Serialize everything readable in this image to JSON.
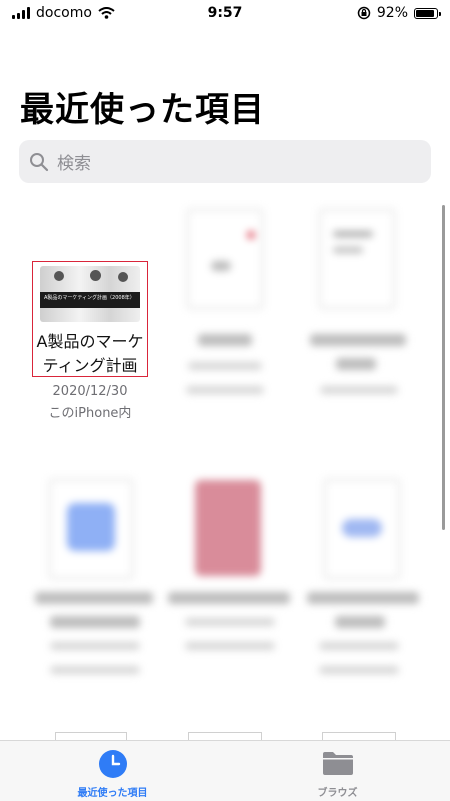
{
  "status": {
    "carrier": "docomo",
    "time": "9:57",
    "battery": "92%"
  },
  "page_title": "最近使った項目",
  "search": {
    "placeholder": "検索"
  },
  "files": [
    {
      "name_line1": "A製品のマーケ",
      "name_line2": "ティング計画",
      "date": "2020/12/30",
      "location": "このiPhone内",
      "thumb_caption": "A製品のマーケティング計画（2008年）"
    }
  ],
  "tabbar": {
    "recent_label": "最近使った項目",
    "browse_label": "ブラウズ"
  },
  "colors": {
    "accent": "#2f7cf6",
    "selection": "#d9253a",
    "inactive": "#8e8e93"
  }
}
